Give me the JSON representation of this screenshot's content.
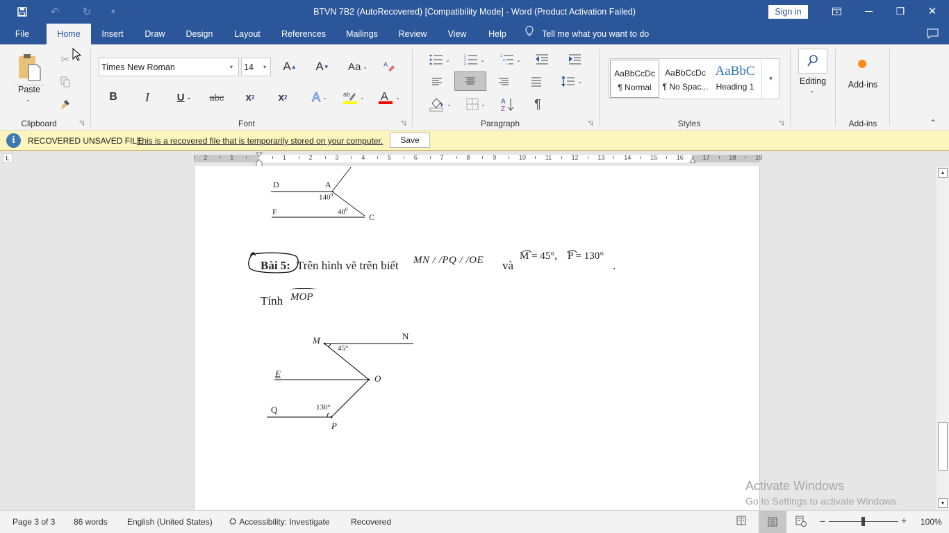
{
  "window": {
    "title": "BTVN 7B2 (AutoRecovered) [Compatibility Mode]  -  Word (Product Activation Failed)",
    "sign_in": "Sign in",
    "qat": {
      "save": "save-icon",
      "undo": "undo-icon",
      "redo": "redo-icon",
      "customize": "customize-qat-icon"
    },
    "controls": {
      "ribbon_display": "ribbon-display-options-icon",
      "minimize": "—",
      "restore": "❐",
      "close": "✕"
    }
  },
  "tabs": [
    {
      "label": "File"
    },
    {
      "label": "Home",
      "active": true
    },
    {
      "label": "Insert"
    },
    {
      "label": "Draw"
    },
    {
      "label": "Design"
    },
    {
      "label": "Layout"
    },
    {
      "label": "References"
    },
    {
      "label": "Mailings"
    },
    {
      "label": "Review"
    },
    {
      "label": "View"
    },
    {
      "label": "Help"
    }
  ],
  "tell_me": "Tell me what you want to do",
  "ribbon": {
    "clipboard": {
      "label": "Clipboard",
      "paste": "Paste"
    },
    "font": {
      "label": "Font",
      "font_name": "Times New Roman",
      "font_size": "14",
      "grow": "A",
      "shrink": "A",
      "change_case": "Aa",
      "bold": "B",
      "italic": "I",
      "underline": "U",
      "strike": "abc",
      "sub": "x",
      "sup": "x",
      "highlight_color": "#ffff00",
      "font_color": "#ff0000"
    },
    "paragraph": {
      "label": "Paragraph",
      "active_alignment": "center",
      "pilcrow": "¶"
    },
    "styles": {
      "label": "Styles",
      "items": [
        {
          "preview": "AaBbCcDc",
          "name": "¶ Normal",
          "selected": true
        },
        {
          "preview": "AaBbCcDc",
          "name": "¶ No Spac..."
        },
        {
          "preview": "AaBbC",
          "name": "Heading 1"
        }
      ]
    },
    "editing": {
      "label": "Editing"
    },
    "addins": {
      "button": "Add-ins",
      "label": "Add-ins"
    }
  },
  "message_bar": {
    "title": "RECOVERED UNSAVED FILE",
    "text": "This is a recovered file that is temporarily stored on your computer.",
    "save": "Save"
  },
  "ruler": {
    "left_numbers": [
      "2",
      "1"
    ],
    "right_numbers": [
      "1",
      "2",
      "3",
      "4",
      "5",
      "6",
      "7",
      "8",
      "9",
      "10",
      "11",
      "12",
      "13",
      "14",
      "15",
      "16",
      "17",
      "18",
      "19"
    ]
  },
  "document": {
    "figure1": {
      "labels": {
        "D": "D",
        "A": "A",
        "F": "F",
        "C": "C"
      },
      "angle1": "140",
      "angle2": "40",
      "deg_sup": "0"
    },
    "exercise": {
      "heading": "Bài 5:",
      "text": "Trên hình vẽ trên biết",
      "parallel": "MN / /PQ / /OE",
      "and": "và",
      "given_m": "M = 45°,",
      "given_p": "P = 130°",
      "period": ".",
      "compute": "Tính",
      "target": "MOP"
    },
    "figure2": {
      "M": "M",
      "N": "N",
      "E": "E",
      "O": "O",
      "Q": "Q",
      "P": "P",
      "angle_m": "45°",
      "angle_p": "130°"
    }
  },
  "status": {
    "page": "Page 3 of 3",
    "words": "86 words",
    "language": "English (United States)",
    "accessibility": "Accessibility: Investigate",
    "recovered": "Recovered",
    "zoom": "100%",
    "zoom_level_percent": 100,
    "active_view": "print-layout"
  },
  "watermark": {
    "line1": "Activate Windows",
    "line2": "Go to Settings to activate Windows."
  }
}
